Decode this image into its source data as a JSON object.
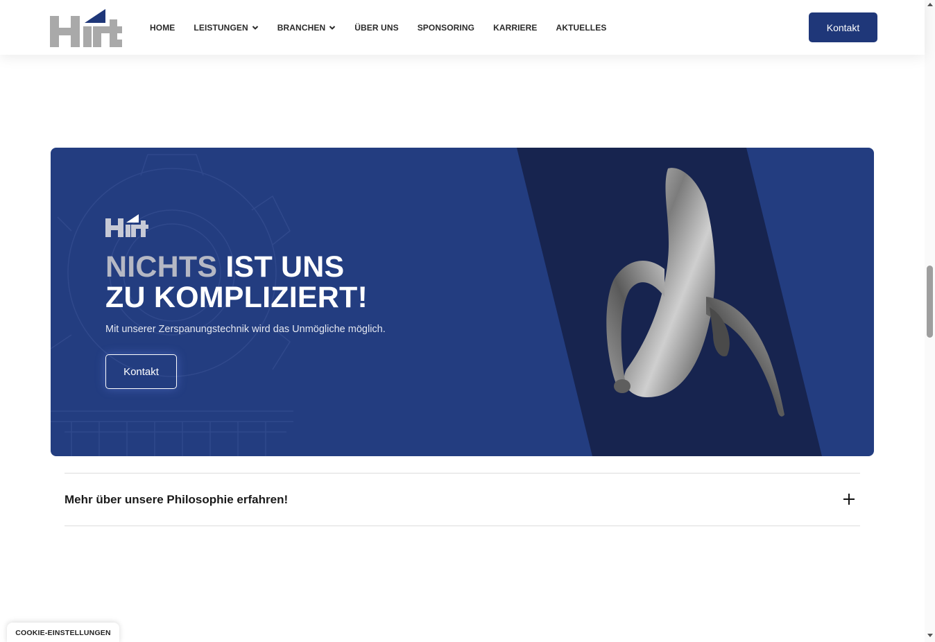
{
  "header": {
    "logo_alt": "Hirt",
    "nav": [
      {
        "label": "HOME",
        "dropdown": false
      },
      {
        "label": "LEISTUNGEN",
        "dropdown": true
      },
      {
        "label": "BRANCHEN",
        "dropdown": true
      },
      {
        "label": "ÜBER UNS",
        "dropdown": false
      },
      {
        "label": "SPONSORING",
        "dropdown": false
      },
      {
        "label": "KARRIERE",
        "dropdown": false
      },
      {
        "label": "AKTUELLES",
        "dropdown": false
      }
    ],
    "cta_label": "Kontakt"
  },
  "hero": {
    "title_gray": "NICHTS",
    "title_white_1": " IST UNS",
    "title_white_2": "ZU KOMPLIZIERT!",
    "subtitle": "Mit unserer Zerspanungstechnik wird das Unmögliche möglich.",
    "button_label": "Kontakt",
    "image": "metal-banana-sculpture"
  },
  "accordion": {
    "label": "Mehr über unsere Philosophie erfahren!",
    "icon": "plus-icon"
  },
  "cookie": {
    "label": "COOKIE-EINSTELLUNGEN"
  },
  "colors": {
    "brand_blue": "#1f3779",
    "hero_blue": "#233d80",
    "hero_dark_band": "#17244f",
    "logo_gray": "#a9a9a9"
  }
}
